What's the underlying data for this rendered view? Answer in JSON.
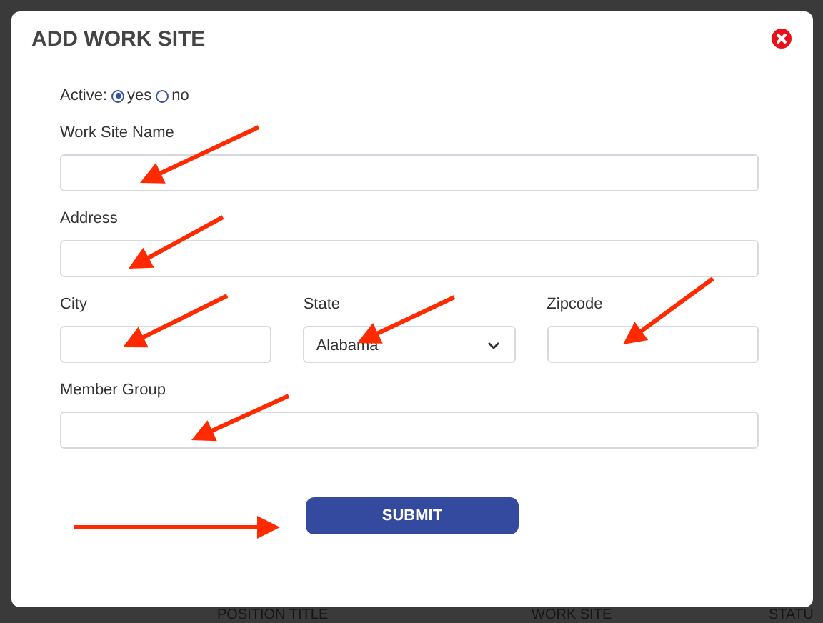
{
  "dialog": {
    "title": "ADD WORK SITE",
    "active": {
      "label": "Active:",
      "options": [
        {
          "label": "yes",
          "selected": true
        },
        {
          "label": "no",
          "selected": false
        }
      ]
    },
    "rows": [
      {
        "fields": [
          {
            "kind": "text",
            "label": "Work Site Name"
          }
        ]
      },
      {
        "fields": [
          {
            "kind": "text",
            "label": "Address"
          }
        ]
      },
      {
        "fields": [
          {
            "kind": "text",
            "label": "City"
          },
          {
            "kind": "select",
            "label": "State",
            "value": "Alabama"
          },
          {
            "kind": "text",
            "label": "Zipcode"
          }
        ]
      },
      {
        "fields": [
          {
            "kind": "text",
            "label": "Member Group"
          }
        ]
      }
    ],
    "submit": "SUBMIT"
  },
  "background_table": {
    "columns": [
      "POSITION TITLE",
      "WORK SITE",
      "STATU"
    ]
  }
}
